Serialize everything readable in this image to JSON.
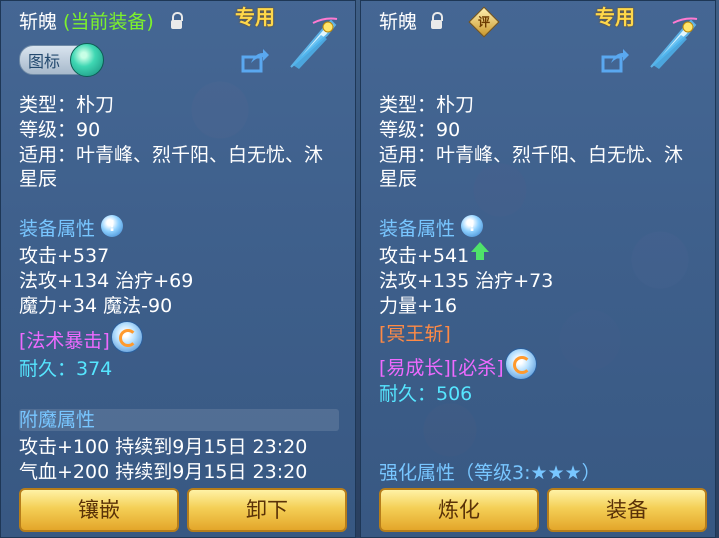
{
  "left": {
    "title": "斩魄",
    "current_tag": "(当前装备)",
    "special_label": "专用",
    "icon_toggle_label": "图标",
    "type_line": "类型：朴刀",
    "level_line": "等级：90",
    "usable_line1": "适用：叶青峰、烈千阳、白无忧、沐",
    "usable_line2": "星辰",
    "attr_header": "装备属性",
    "attr_lines": [
      "攻击+537",
      "法攻+134 治疗+69",
      "魔力+34 魔法-90"
    ],
    "special_attr": "[法术暴击]",
    "durability": "耐久：374",
    "enchant_header": "附魔属性",
    "enchant_lines": [
      "攻击+100 持续到9月15日 23:20",
      "气血+200 持续到9月15日 23:20"
    ],
    "buttons": [
      "镶嵌",
      "卸下"
    ],
    "icons": {
      "lock": "lock-icon",
      "share": "share-icon",
      "weapon": "blade-weapon-icon",
      "info": "info-icon",
      "refresh": "refresh-icon"
    }
  },
  "right": {
    "title": "斩魄",
    "badge": "评",
    "special_label": "专用",
    "type_line": "类型：朴刀",
    "level_line": "等级：90",
    "usable_line1": "适用：叶青峰、烈千阳、白无忧、沐",
    "usable_line2": "星辰",
    "attr_header": "装备属性",
    "attr_lines": [
      "攻击+541",
      "法攻+135 治疗+73",
      "力量+16"
    ],
    "skill": "[冥王斩]",
    "special_attr": "[易成长][必杀]",
    "durability": "耐久：506",
    "strengthen": "强化属性（等级3:★★★）",
    "buttons": [
      "炼化",
      "装备"
    ],
    "icons": {
      "lock": "lock-icon",
      "share": "share-icon",
      "weapon": "blade-weapon-icon",
      "info": "info-icon",
      "refresh": "refresh-icon",
      "up": "up-arrow-icon"
    }
  },
  "colors": {
    "gold": "#ffe36a",
    "green": "#7df22c",
    "blue": "#78c6ff",
    "cyan": "#56e6ff",
    "magenta": "#ee6aff",
    "orange": "#ff8a45"
  }
}
